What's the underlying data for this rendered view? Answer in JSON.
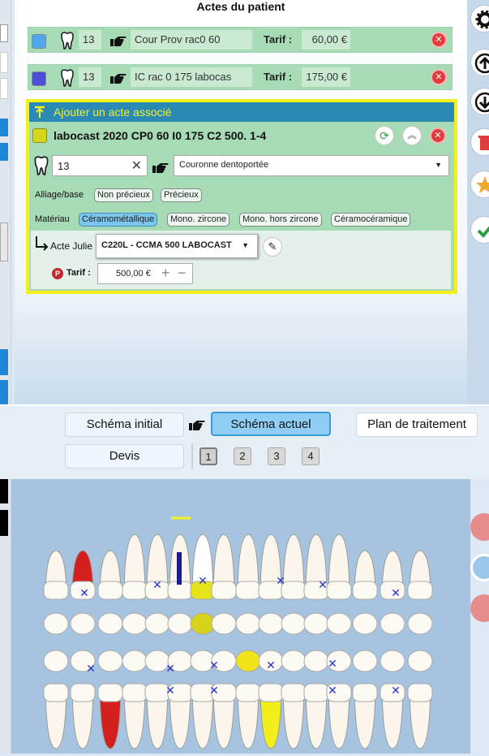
{
  "panel": {
    "title": "Actes du patient"
  },
  "acts": [
    {
      "color": "#4fa8ea",
      "tooth": "13",
      "label": "Cour Prov rac0 60",
      "tarif_label": "Tarif :",
      "tarif": "60,00 €"
    },
    {
      "color": "#4b4fd6",
      "tooth": "13",
      "label": "IC rac 0 175 labocas",
      "tarif_label": "Tarif :",
      "tarif": "175,00 €"
    }
  ],
  "assoc": {
    "header": "Ajouter un acte associé",
    "color": "#d4d61c",
    "title": "labocast 2020 CP0 60 I0 175 C2  500.  1-4",
    "tooth": "13",
    "act_type": "Couronne dentoportée",
    "alliage_label": "Alliage/base",
    "alliage_options": [
      "Non précieux",
      "Précieux"
    ],
    "materiau_label": "Matériau",
    "materiau_options": [
      "Céramométallique",
      "Mono. zircone",
      "Mono. hors zircone",
      "Céramocéramique"
    ],
    "materiau_selected": "Céramométallique",
    "acte_label": "Acte Julie",
    "acte_value": "C220L - CCMA 500 LABOCAST",
    "tarif_label": "Tarif :",
    "tarif": "500,00 €",
    "tarif_badge": "P"
  },
  "right_toolbar": [
    "gear-icon",
    "arrow-up-icon",
    "arrow-down-icon",
    "trash-icon",
    "star-icon",
    "check-icon"
  ],
  "schema": {
    "initial": "Schéma initial",
    "actuel": "Schéma actuel",
    "plan": "Plan de traitement",
    "devis": "Devis",
    "pages": [
      "1",
      "2",
      "3",
      "4"
    ],
    "active_page": "1"
  },
  "colors": {
    "accent": "#2b8ab4",
    "selection": "#f4f01b",
    "act_green": "#a7dbb6",
    "danger": "#e23b3b",
    "chart_bg": "#a6c4df"
  }
}
